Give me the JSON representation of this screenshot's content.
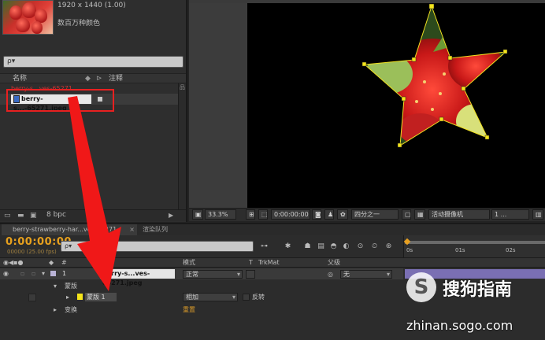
{
  "project": {
    "info_line1": "1920 x 1440 (1.00)",
    "info_line2": "数百万种颜色",
    "search_placeholder": "ρ▾",
    "col_name": "名称",
    "col_comment": "注释",
    "folder_label": "berry-s...ves-65271",
    "item_label": "berry-s...-65271.jpeg",
    "bpc": "8 bpc"
  },
  "viewer": {
    "zoom": "33.3%",
    "timecode": "0:00:00:00",
    "resolution": "四分之一",
    "camera": "活动摄像机",
    "views": "1 ..."
  },
  "timeline": {
    "tab_label": "berry-strawberry-har...ves-65271",
    "render_tab": "渲染队列",
    "timecode": "0:00:00:00",
    "fps": "00000 (25.00 fps)",
    "ruler_ticks": [
      "0s",
      "01s",
      "02s"
    ],
    "col_mode": "模式",
    "col_t": "T",
    "col_trkmat": "TrkMat",
    "col_parent": "父级",
    "layer_num": "1",
    "layer_name": "berry-s...ves-65271.jpeg",
    "layer_mode": "正常",
    "layer_parent": "无",
    "masks_group": "蒙版",
    "mask_name": "蒙版 1",
    "mask_mode": "相加",
    "mask_invert": "反转",
    "transform_group": "变换",
    "transform_reset": "重置"
  },
  "watermark": {
    "brand": "搜狗指南",
    "url": "zhinan.sogo.com"
  },
  "colors": {
    "accent": "#e6a01e",
    "highlight_red": "#e82020",
    "mask_yellow": "#f5e51a",
    "layer_bar": "#7a6fb3"
  }
}
